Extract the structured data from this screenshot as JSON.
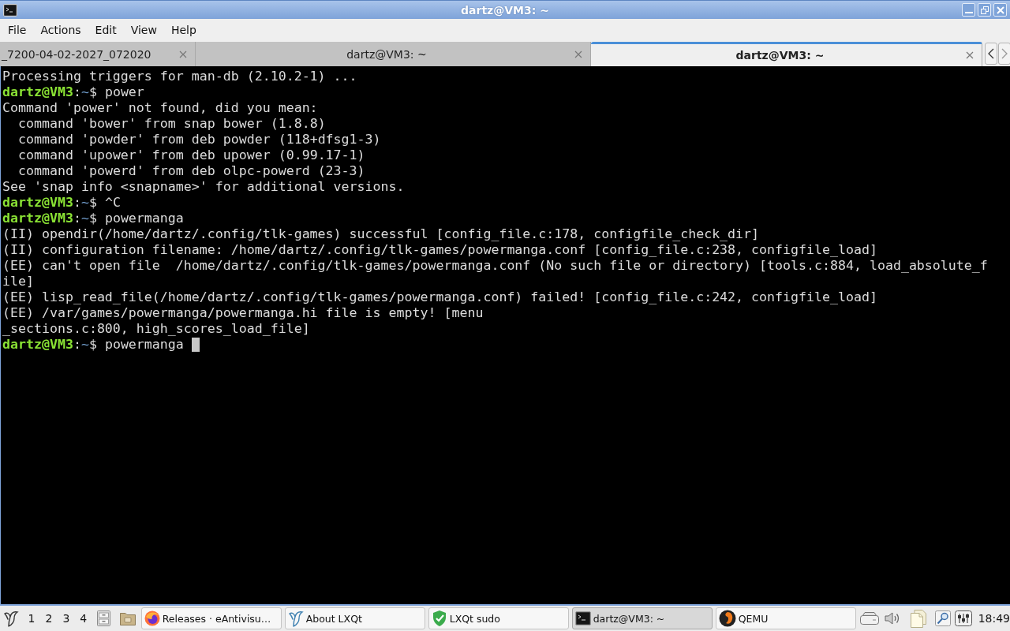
{
  "window": {
    "title": "dartz@VM3: ~"
  },
  "menu": [
    "File",
    "Actions",
    "Edit",
    "View",
    "Help"
  ],
  "tabs": [
    {
      "label": "_7200-04-02-2027_072020",
      "selected": false
    },
    {
      "label": "dartz@VM3: ~",
      "selected": false
    },
    {
      "label": "dartz@VM3: ~",
      "selected": true
    }
  ],
  "terminal": {
    "lines": [
      {
        "kind": "output",
        "text": "Processing triggers for man-db (2.10.2-1) ..."
      },
      {
        "kind": "prompt",
        "user": "dartz@VM3",
        "colon": ":",
        "path": "~",
        "dollar": "$",
        "command": "power",
        "cursor": false
      },
      {
        "kind": "output",
        "text": "Command 'power' not found, did you mean:"
      },
      {
        "kind": "suggestion",
        "text": "command 'bower' from snap bower (1.8.8)"
      },
      {
        "kind": "suggestion",
        "text": "command 'powder' from deb powder (118+dfsg1-3)"
      },
      {
        "kind": "suggestion",
        "text": "command 'upower' from deb upower (0.99.17-1)"
      },
      {
        "kind": "suggestion",
        "text": "command 'powerd' from deb olpc-powerd (23-3)"
      },
      {
        "kind": "output",
        "text": "See 'snap info <snapname>' for additional versions."
      },
      {
        "kind": "prompt",
        "user": "dartz@VM3",
        "colon": ":",
        "path": "~",
        "dollar": "$",
        "command": "^C",
        "cursor": false
      },
      {
        "kind": "prompt",
        "user": "dartz@VM3",
        "colon": ":",
        "path": "~",
        "dollar": "$",
        "command": "powermanga",
        "cursor": false
      },
      {
        "kind": "output",
        "text": "(II) opendir(/home/dartz/.config/tlk-games) successful [config_file.c:178, configfile_check_dir]"
      },
      {
        "kind": "output",
        "text": "(II) configuration filename: /home/dartz/.config/tlk-games/powermanga.conf [config_file.c:238, configfile_load]"
      },
      {
        "kind": "output",
        "text": "(EE) can't open file  /home/dartz/.config/tlk-games/powermanga.conf (No such file or directory) [tools.c:884, load_absolute_f"
      },
      {
        "kind": "output",
        "text": "ile]"
      },
      {
        "kind": "output",
        "text": "(EE) lisp_read_file(/home/dartz/.config/tlk-games/powermanga.conf) failed! [config_file.c:242, configfile_load]"
      },
      {
        "kind": "output",
        "text": "(EE) /var/games/powermanga/powermanga.hi file is empty! [menu"
      },
      {
        "kind": "output",
        "text": "_sections.c:800, high_scores_load_file]"
      },
      {
        "kind": "prompt",
        "user": "dartz@VM3",
        "colon": ":",
        "path": "~",
        "dollar": "$",
        "command": "powermanga",
        "cursor": true
      }
    ]
  },
  "taskbar": {
    "workspaces": [
      "1",
      "2",
      "3",
      "4"
    ],
    "tasks": [
      {
        "label": "Releases · eAntivisu…",
        "kind": "browser",
        "selected": false
      },
      {
        "label": "About LXQt",
        "kind": "about",
        "selected": false
      },
      {
        "label": "LXQt sudo",
        "kind": "sudo",
        "selected": false
      },
      {
        "label": "dartz@VM3: ~",
        "kind": "terminal",
        "selected": true
      },
      {
        "label": "QEMU",
        "kind": "emulator",
        "selected": false
      }
    ],
    "clock": "18:49"
  }
}
